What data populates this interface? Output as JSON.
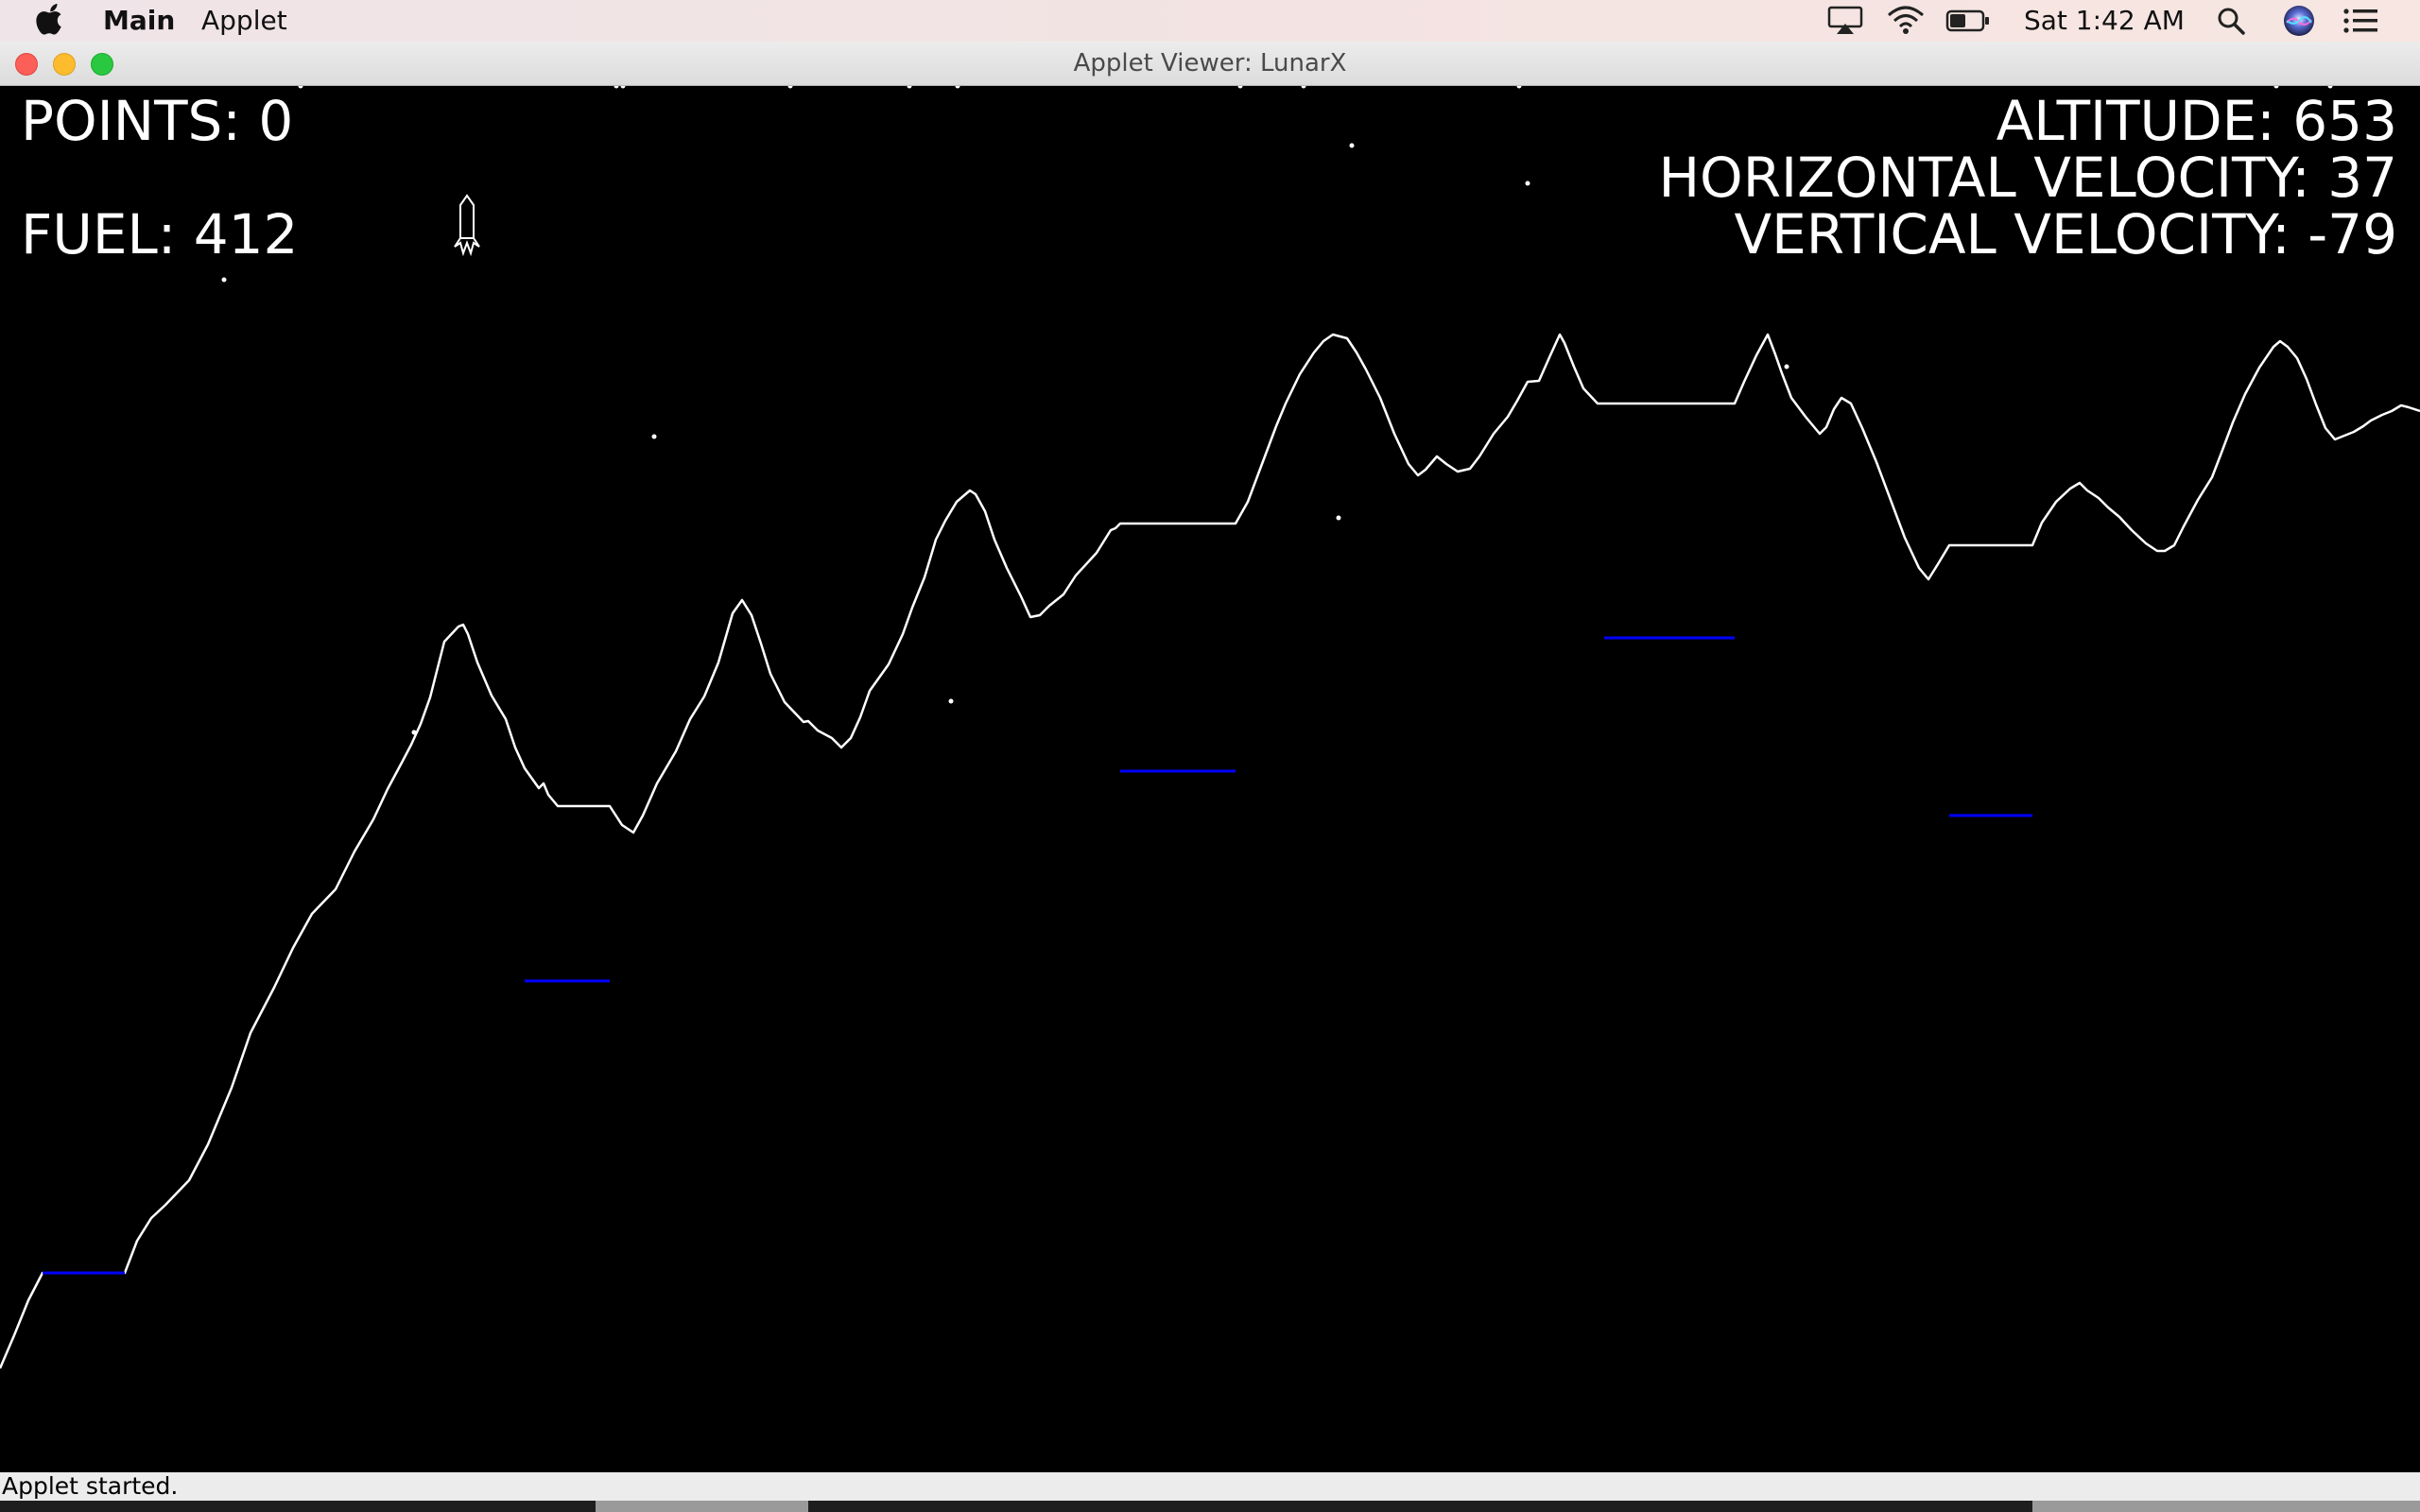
{
  "menubar": {
    "apple_icon": "apple-logo-icon",
    "app_name": "Main",
    "menu_applet": "Applet",
    "clock": "Sat 1:42 AM",
    "status_icons": [
      "airplay-icon",
      "wifi-icon",
      "battery-icon",
      "search-icon",
      "siri-icon",
      "notification-center-icon"
    ]
  },
  "window": {
    "title": "Applet Viewer: LunarX",
    "buttons": [
      "close",
      "minimize",
      "zoom"
    ]
  },
  "hud": {
    "points": "POINTS: 0",
    "fuel": "FUEL: 412",
    "altitude": "ALTITUDE: 653",
    "horizontal_velocity": "HORIZONTAL VELOCITY: 37",
    "vertical_velocity": "VERTICAL VELOCITY: -79"
  },
  "game": {
    "terrain_color": "#ffffff",
    "landing_pad_color": "#0000ff",
    "landing_pads": 5,
    "background": "#000000"
  },
  "status": {
    "text": "Applet started."
  }
}
